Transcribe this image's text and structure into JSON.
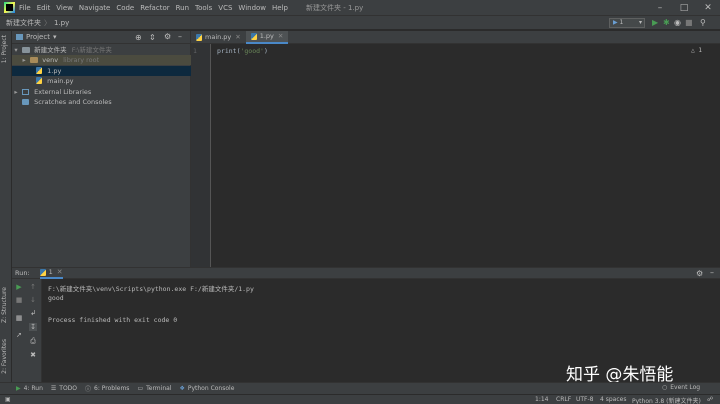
{
  "menubar": {
    "items": [
      "File",
      "Edit",
      "View",
      "Navigate",
      "Code",
      "Refactor",
      "Run",
      "Tools",
      "VCS",
      "Window",
      "Help"
    ],
    "window_title": "新建文件夹 - 1.py"
  },
  "navbar": {
    "breadcrumb_root": "新建文件夹",
    "breadcrumb_sep": "〉",
    "breadcrumb_file": "1.py",
    "run_config": "1"
  },
  "left_strip": {
    "project_tab": "1: Project",
    "structure_tab": "Z: Structure",
    "favorites_tab": "2: Favorites"
  },
  "project_panel": {
    "title": "Project",
    "tree": {
      "root_name": "新建文件夹",
      "root_path": "F:\\新建文件夹",
      "venv_name": "venv",
      "venv_note": "library root",
      "file_1": "1.py",
      "file_main": "main.py",
      "external_libraries": "External Libraries",
      "scratches": "Scratches and Consoles"
    }
  },
  "editor": {
    "tabs": [
      {
        "label": "main.py",
        "active": false
      },
      {
        "label": "1.py",
        "active": true
      }
    ],
    "line_number": "1",
    "code_prefix": "print(",
    "code_string": "'good'",
    "code_suffix": ")",
    "inspection": "1"
  },
  "run_window": {
    "label": "Run:",
    "tab": "1",
    "lines": [
      "F:\\新建文件夹\\venv\\Scripts\\python.exe F:/新建文件夹/1.py",
      "good",
      "",
      "Process finished with exit code 0"
    ]
  },
  "watermark": "知乎 @朱悟能",
  "bottom_tools": {
    "run": "4: Run",
    "todo": "TODO",
    "problems": "6: Problems",
    "terminal": "Terminal",
    "python_console": "Python Console",
    "event_log": "Event Log"
  },
  "statusbar": {
    "position": "1:14",
    "line_sep": "CRLF",
    "encoding": "UTF-8",
    "indent": "4 spaces",
    "interpreter": "Python 3.8 (新建文件夹)"
  },
  "colors": {
    "accent": "#4a88c7",
    "run_green": "#499c54",
    "string_green": "#6a8759"
  }
}
